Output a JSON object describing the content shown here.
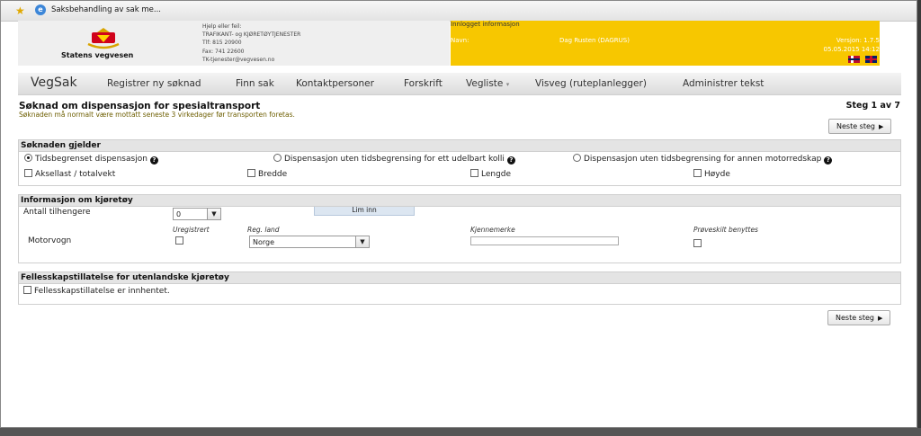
{
  "window": {
    "title": "Saksbehandling av sak me..."
  },
  "header": {
    "org_name": "Statens vegvesen",
    "contact_lines": [
      "Hjelp eller feil:",
      "TRAFIKANT- og KJØRETØYTJENESTER",
      "Tlf: 815 20900",
      "Fax: 741 22600",
      "TK-tjenester@vegvesen.no"
    ],
    "logged_in_title": "Innlogget informasjon",
    "name_label": "Navn:",
    "user": "Dag Rusten (DAGRUS)",
    "version": "Versjon: 1.7.5",
    "datetime": "05.05.2015 14:12",
    "colors": {
      "banner": "#f7c700",
      "logo_red": "#d0021b"
    }
  },
  "menu": {
    "brand": "VegSak",
    "items": [
      "Registrer ny søknad",
      "Finn sak",
      "Kontaktpersoner",
      "Forskrift",
      "Vegliste",
      "Visveg (ruteplanlegger)",
      "Administrer tekst"
    ]
  },
  "page": {
    "title": "Søknad om dispensasjon for spesialtransport",
    "note": "Søknaden må normalt være mottatt seneste 3 virkedager før transporten foretas.",
    "step": "Steg 1 av 7",
    "next_label": "Neste steg"
  },
  "soknaden": {
    "title": "Søknaden gjelder",
    "radios": [
      "Tidsbegrenset dispensasjon",
      "Dispensasjon uten tidsbegrensing for ett udelbart kolli",
      "Dispensasjon uten tidsbegrensing for annen motorredskap"
    ],
    "checkboxes": [
      "Aksellast / totalvekt",
      "Bredde",
      "Lengde",
      "Høyde"
    ]
  },
  "lim_inn": "Lim inn",
  "kjoretoy": {
    "title": "Informasjon om kjøretøy",
    "tilhengere_label": "Antall tilhengere",
    "tilhengere_value": "0",
    "col_uregistrert": "Uregistrert",
    "col_reg_land": "Reg. land",
    "col_kjennemerke": "Kjennemerke",
    "col_proveskilt": "Prøveskilt benyttes",
    "row_label": "Motorvogn",
    "reg_land_value": "Norge"
  },
  "felles": {
    "title": "Fellesskapstillatelse for utenlandske kjøretøy",
    "checkbox": "Fellesskapstillatelse er innhentet."
  }
}
